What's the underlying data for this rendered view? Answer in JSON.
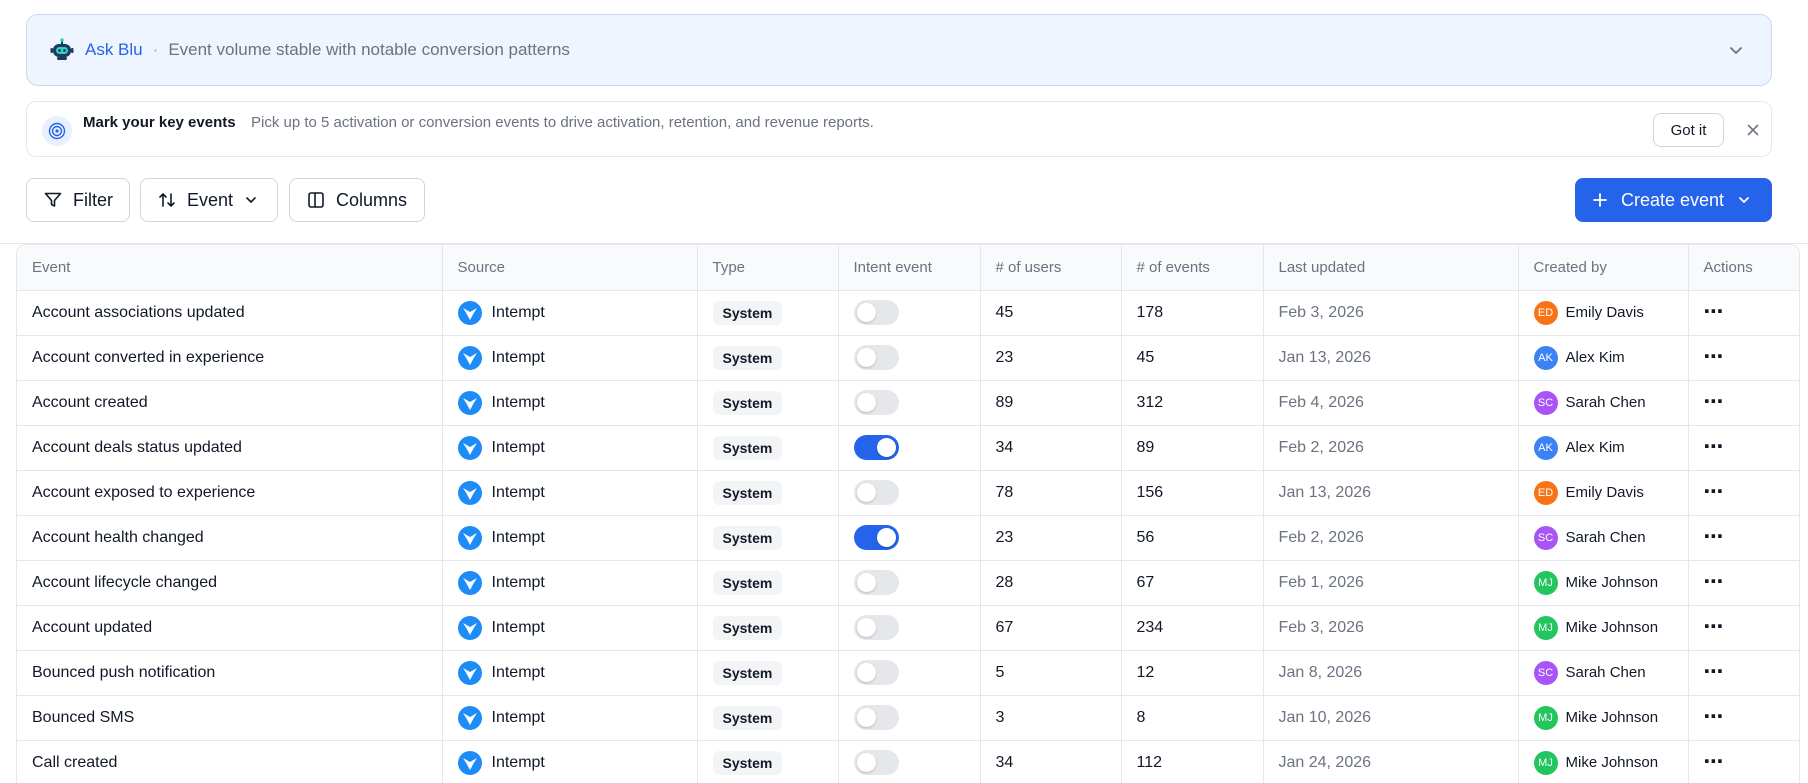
{
  "ask_blu": {
    "title": "Ask Blu",
    "separator": "·",
    "summary": "Event volume stable with notable conversion patterns",
    "expand_icon": "chevron-down-icon"
  },
  "key_events_banner": {
    "title": "Mark your key events",
    "description": "Pick up to 5 activation or conversion events to drive activation, retention, and revenue reports.",
    "got_it_label": "Got it",
    "close_icon": "close-icon"
  },
  "toolbar": {
    "filter_label": "Filter",
    "sort_label": "Event",
    "columns_label": "Columns",
    "create_label": "Create event"
  },
  "colors": {
    "accent": "#2563eb",
    "toggle_off": "#e5e7eb",
    "banner_bg": "#eff5fe"
  },
  "table": {
    "columns": [
      "Event",
      "Source",
      "Type",
      "Intent event",
      "# of users",
      "# of events",
      "Last updated",
      "Created by",
      "Actions"
    ],
    "rows": [
      {
        "event": "Account associations updated",
        "source": "Intempt",
        "type": "System",
        "intent": false,
        "users": "45",
        "events": "178",
        "updated": "Feb 3, 2026",
        "initials": "ED",
        "creator": "Emily Davis",
        "avatar_color": "#f97316"
      },
      {
        "event": "Account converted in experience",
        "source": "Intempt",
        "type": "System",
        "intent": false,
        "users": "23",
        "events": "45",
        "updated": "Jan 13, 2026",
        "initials": "AK",
        "creator": "Alex Kim",
        "avatar_color": "#3b82f6"
      },
      {
        "event": "Account created",
        "source": "Intempt",
        "type": "System",
        "intent": false,
        "users": "89",
        "events": "312",
        "updated": "Feb 4, 2026",
        "initials": "SC",
        "creator": "Sarah Chen",
        "avatar_color": "#a855f7"
      },
      {
        "event": "Account deals status updated",
        "source": "Intempt",
        "type": "System",
        "intent": true,
        "users": "34",
        "events": "89",
        "updated": "Feb 2, 2026",
        "initials": "AK",
        "creator": "Alex Kim",
        "avatar_color": "#3b82f6"
      },
      {
        "event": "Account exposed to experience",
        "source": "Intempt",
        "type": "System",
        "intent": false,
        "users": "78",
        "events": "156",
        "updated": "Jan 13, 2026",
        "initials": "ED",
        "creator": "Emily Davis",
        "avatar_color": "#f97316"
      },
      {
        "event": "Account health changed",
        "source": "Intempt",
        "type": "System",
        "intent": true,
        "users": "23",
        "events": "56",
        "updated": "Feb 2, 2026",
        "initials": "SC",
        "creator": "Sarah Chen",
        "avatar_color": "#a855f7"
      },
      {
        "event": "Account lifecycle changed",
        "source": "Intempt",
        "type": "System",
        "intent": false,
        "users": "28",
        "events": "67",
        "updated": "Feb 1, 2026",
        "initials": "MJ",
        "creator": "Mike Johnson",
        "avatar_color": "#22c55e"
      },
      {
        "event": "Account updated",
        "source": "Intempt",
        "type": "System",
        "intent": false,
        "users": "67",
        "events": "234",
        "updated": "Feb 3, 2026",
        "initials": "MJ",
        "creator": "Mike Johnson",
        "avatar_color": "#22c55e"
      },
      {
        "event": "Bounced push notification",
        "source": "Intempt",
        "type": "System",
        "intent": false,
        "users": "5",
        "events": "12",
        "updated": "Jan 8, 2026",
        "initials": "SC",
        "creator": "Sarah Chen",
        "avatar_color": "#a855f7"
      },
      {
        "event": "Bounced SMS",
        "source": "Intempt",
        "type": "System",
        "intent": false,
        "users": "3",
        "events": "8",
        "updated": "Jan 10, 2026",
        "initials": "MJ",
        "creator": "Mike Johnson",
        "avatar_color": "#22c55e"
      },
      {
        "event": "Call created",
        "source": "Intempt",
        "type": "System",
        "intent": false,
        "users": "34",
        "events": "112",
        "updated": "Jan 24, 2026",
        "initials": "MJ",
        "creator": "Mike Johnson",
        "avatar_color": "#22c55e"
      }
    ]
  }
}
